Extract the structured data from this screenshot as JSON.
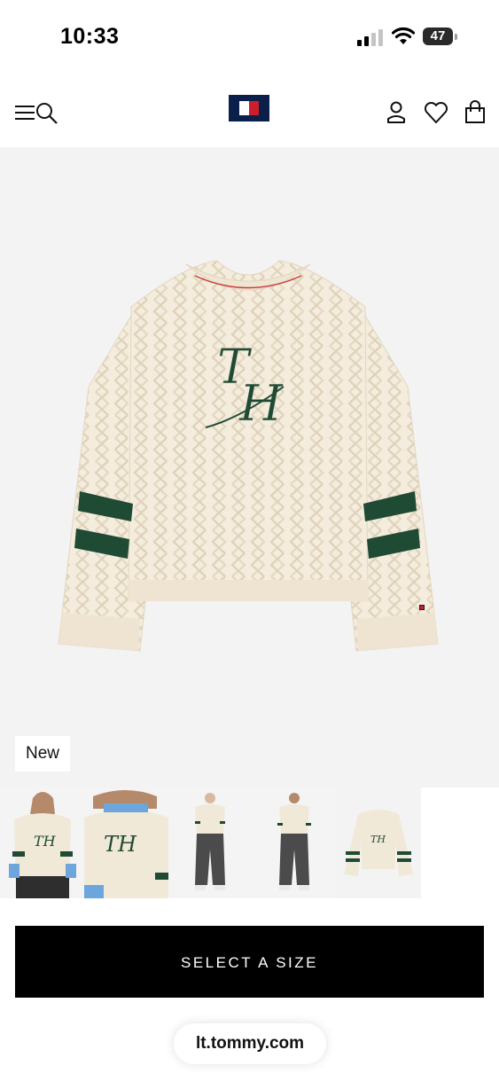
{
  "status_bar": {
    "time": "10:33",
    "battery_percent": "47",
    "battery_level": 0.47
  },
  "nav": {
    "menu_icon": "menu-icon",
    "search_icon": "search-icon",
    "logo": "tommy-hilfiger-flag-logo",
    "account_icon": "account-icon",
    "wishlist_icon": "heart-icon",
    "bag_icon": "bag-icon"
  },
  "product": {
    "badge": "New",
    "monogram": "TH",
    "colors": {
      "knit": "#f4ecdc",
      "stripe": "#1f4a34",
      "background": "#f3f3f4"
    }
  },
  "thumbnails": [
    {
      "name": "model-front"
    },
    {
      "name": "model-closeup"
    },
    {
      "name": "model-full-front"
    },
    {
      "name": "model-full-back"
    },
    {
      "name": "product-flat"
    }
  ],
  "cta": {
    "label": "SELECT A SIZE"
  },
  "browser": {
    "url": "lt.tommy.com"
  }
}
